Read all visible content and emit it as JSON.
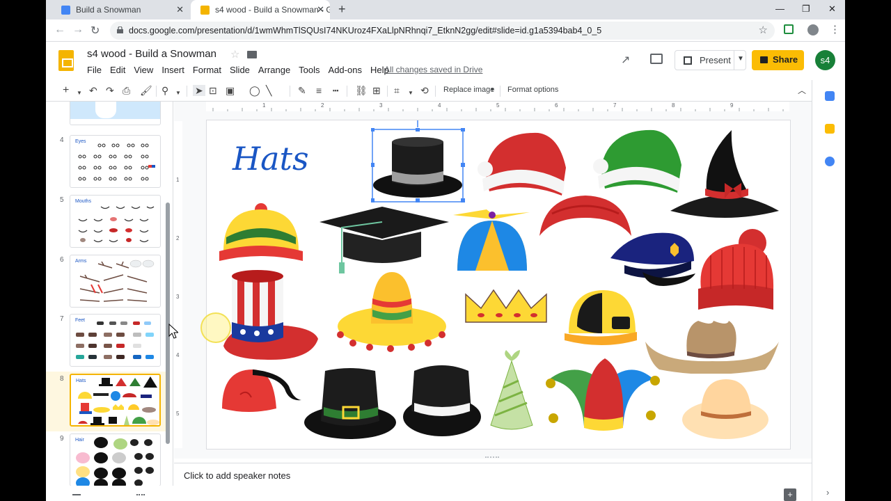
{
  "browser": {
    "tabs": [
      {
        "title": "Build a Snowman",
        "active": false
      },
      {
        "title": "s4 wood - Build a Snowman - Go",
        "active": true
      }
    ],
    "url": "docs.google.com/presentation/d/1wmWhmTlSQUsI74NKUroz4FXaLlpNRhnqi7_EtknN2gg/edit#slide=id.g1a5394bab4_0_5"
  },
  "app": {
    "doc_title": "s4 wood - Build a Snowman",
    "menus": [
      "File",
      "Edit",
      "View",
      "Insert",
      "Format",
      "Slide",
      "Arrange",
      "Tools",
      "Add-ons",
      "Help"
    ],
    "saved_status": "All changes saved in Drive",
    "present_label": "Present",
    "share_label": "Share",
    "avatar_initials": "s4"
  },
  "toolbar": {
    "replace_image": "Replace image",
    "format_options": "Format options"
  },
  "filmstrip": {
    "slides": [
      {
        "num": "4",
        "title": "Eyes"
      },
      {
        "num": "5",
        "title": "Mouths"
      },
      {
        "num": "6",
        "title": "Arms"
      },
      {
        "num": "7",
        "title": "Feet"
      },
      {
        "num": "8",
        "title": "Hats",
        "selected": true
      },
      {
        "num": "9",
        "title": "Hair"
      }
    ]
  },
  "ruler": {
    "marks": [
      "1",
      "2",
      "3",
      "4",
      "5",
      "6",
      "7",
      "8",
      "9"
    ],
    "left_marks": [
      "1",
      "2",
      "3",
      "4",
      "5"
    ]
  },
  "slide": {
    "title": "Hats",
    "hats": [
      "top-hat",
      "santa-hat",
      "elf-hat",
      "witch-hat",
      "beanie",
      "graduation-cap",
      "propeller-cap",
      "visor",
      "police-cap",
      "knit-hat",
      "uncle-sam-hat",
      "sombrero",
      "crown",
      "hard-hat",
      "cowboy-hat",
      "fez",
      "pilgrim-hat",
      "fedora",
      "party-hat",
      "jester-hat",
      "straw-hat"
    ]
  },
  "notes": {
    "placeholder": "Click to add speaker notes"
  },
  "colors": {
    "accent": "#f4b400",
    "brand_blue": "#1a56c4",
    "selection": "#4285f4"
  }
}
